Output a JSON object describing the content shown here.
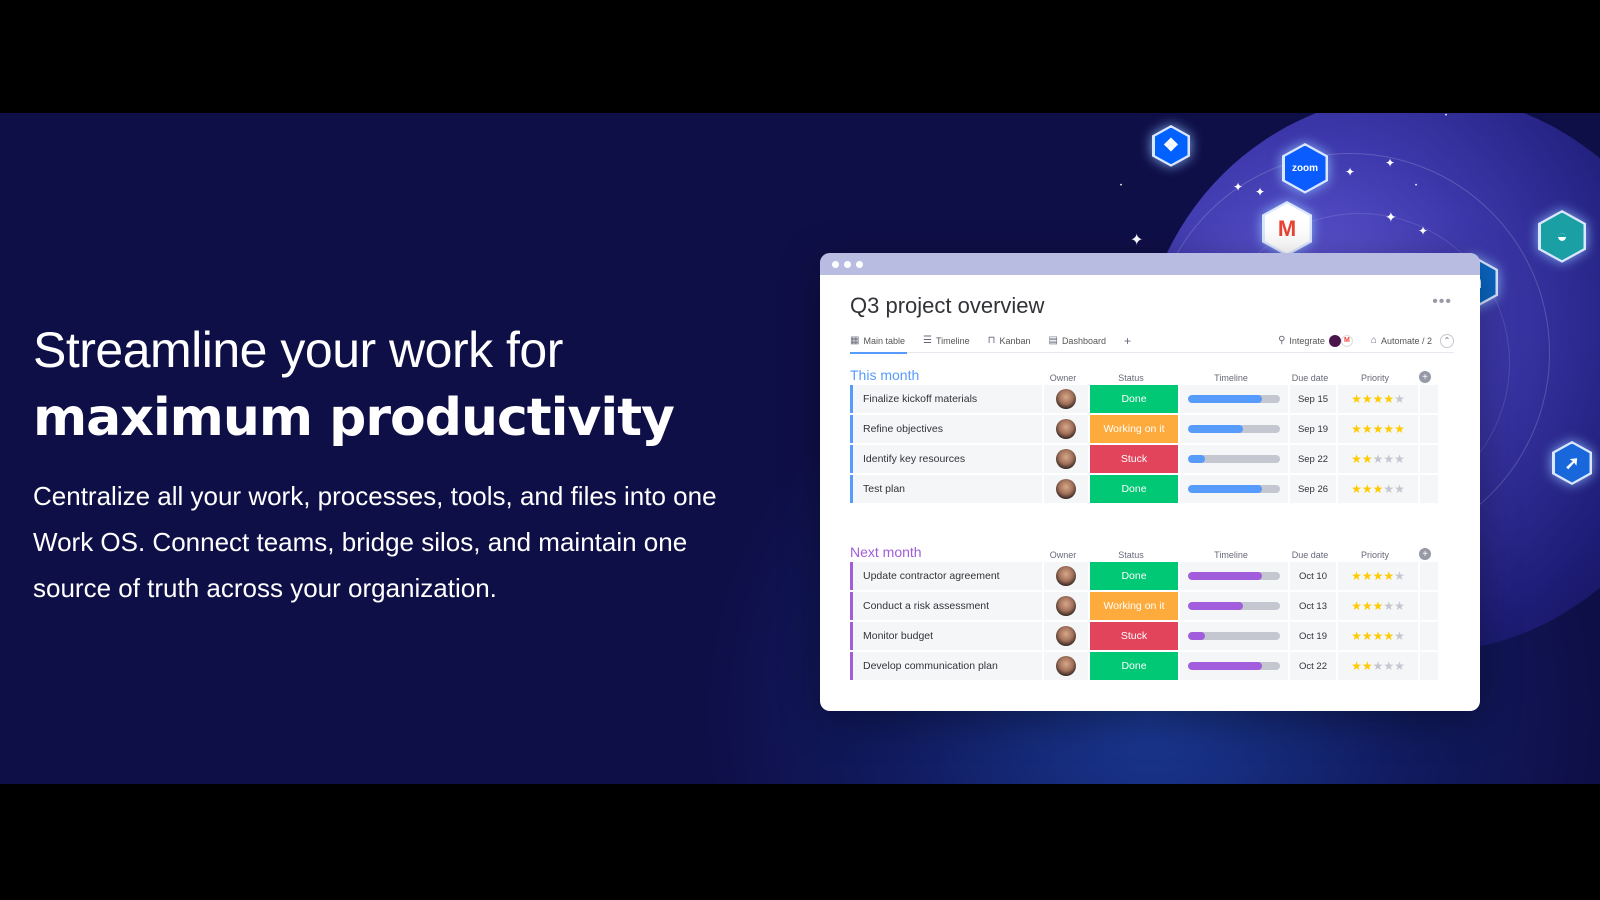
{
  "hero": {
    "headline_line1": "Streamline your work for",
    "headline_line2": "maximum productivity",
    "paragraph": "Centralize all your work, processes, tools, and files into one Work OS. Connect teams, bridge silos, and maintain one source of truth across your organization."
  },
  "integrations": [
    {
      "name": "dropbox",
      "glyph": "❖",
      "color": "#0061fe"
    },
    {
      "name": "zoom",
      "glyph": "zoom",
      "color": "#0b5cff"
    },
    {
      "name": "gmail",
      "glyph": "M",
      "color": "#ffffff"
    },
    {
      "name": "linkedin",
      "glyph": "in",
      "color": "#0a66c2"
    },
    {
      "name": "teams-app",
      "glyph": "◒",
      "color": "#1a9fa4"
    },
    {
      "name": "jira",
      "glyph": "➚",
      "color": "#1868db"
    }
  ],
  "board": {
    "title": "Q3 project overview",
    "more_label": "•••",
    "tabs": [
      {
        "label": "Main table",
        "icon": "table-icon",
        "glyph": "▦",
        "active": true
      },
      {
        "label": "Timeline",
        "icon": "timeline-icon",
        "glyph": "☰",
        "active": false
      },
      {
        "label": "Kanban",
        "icon": "kanban-icon",
        "glyph": "⊓",
        "active": false
      },
      {
        "label": "Dashboard",
        "icon": "dashboard-icon",
        "glyph": "▤",
        "active": false
      }
    ],
    "add_tab_label": "+",
    "integrate_label": "Integrate",
    "automate_label": "Automate / 2",
    "collapse_glyph": "⌃",
    "columns": {
      "owner": "Owner",
      "status": "Status",
      "timeline": "Timeline",
      "due": "Due date",
      "priority": "Priority"
    },
    "groups": [
      {
        "title": "This month",
        "color": "#579bfc",
        "rows": [
          {
            "name": "Finalize kickoff materials",
            "status": "Done",
            "status_color": "#00c875",
            "timeline_progress": 0.8,
            "due": "Sep 15",
            "priority": 4
          },
          {
            "name": "Refine objectives",
            "status": "Working on it",
            "status_color": "#fdab3d",
            "timeline_progress": 0.6,
            "due": "Sep 19",
            "priority": 5
          },
          {
            "name": "Identify key resources",
            "status": "Stuck",
            "status_color": "#e2445c",
            "timeline_progress": 0.18,
            "due": "Sep 22",
            "priority": 2
          },
          {
            "name": "Test plan",
            "status": "Done",
            "status_color": "#00c875",
            "timeline_progress": 0.8,
            "due": "Sep 26",
            "priority": 3
          }
        ]
      },
      {
        "title": "Next month",
        "color": "#a25ddc",
        "rows": [
          {
            "name": "Update contractor agreement",
            "status": "Done",
            "status_color": "#00c875",
            "timeline_progress": 0.8,
            "due": "Oct 10",
            "priority": 4
          },
          {
            "name": "Conduct a risk assessment",
            "status": "Working on it",
            "status_color": "#fdab3d",
            "timeline_progress": 0.6,
            "due": "Oct 13",
            "priority": 3
          },
          {
            "name": "Monitor budget",
            "status": "Stuck",
            "status_color": "#e2445c",
            "timeline_progress": 0.18,
            "due": "Oct 19",
            "priority": 4
          },
          {
            "name": "Develop communication plan",
            "status": "Done",
            "status_color": "#00c875",
            "timeline_progress": 0.8,
            "due": "Oct 22",
            "priority": 2
          }
        ]
      }
    ]
  }
}
